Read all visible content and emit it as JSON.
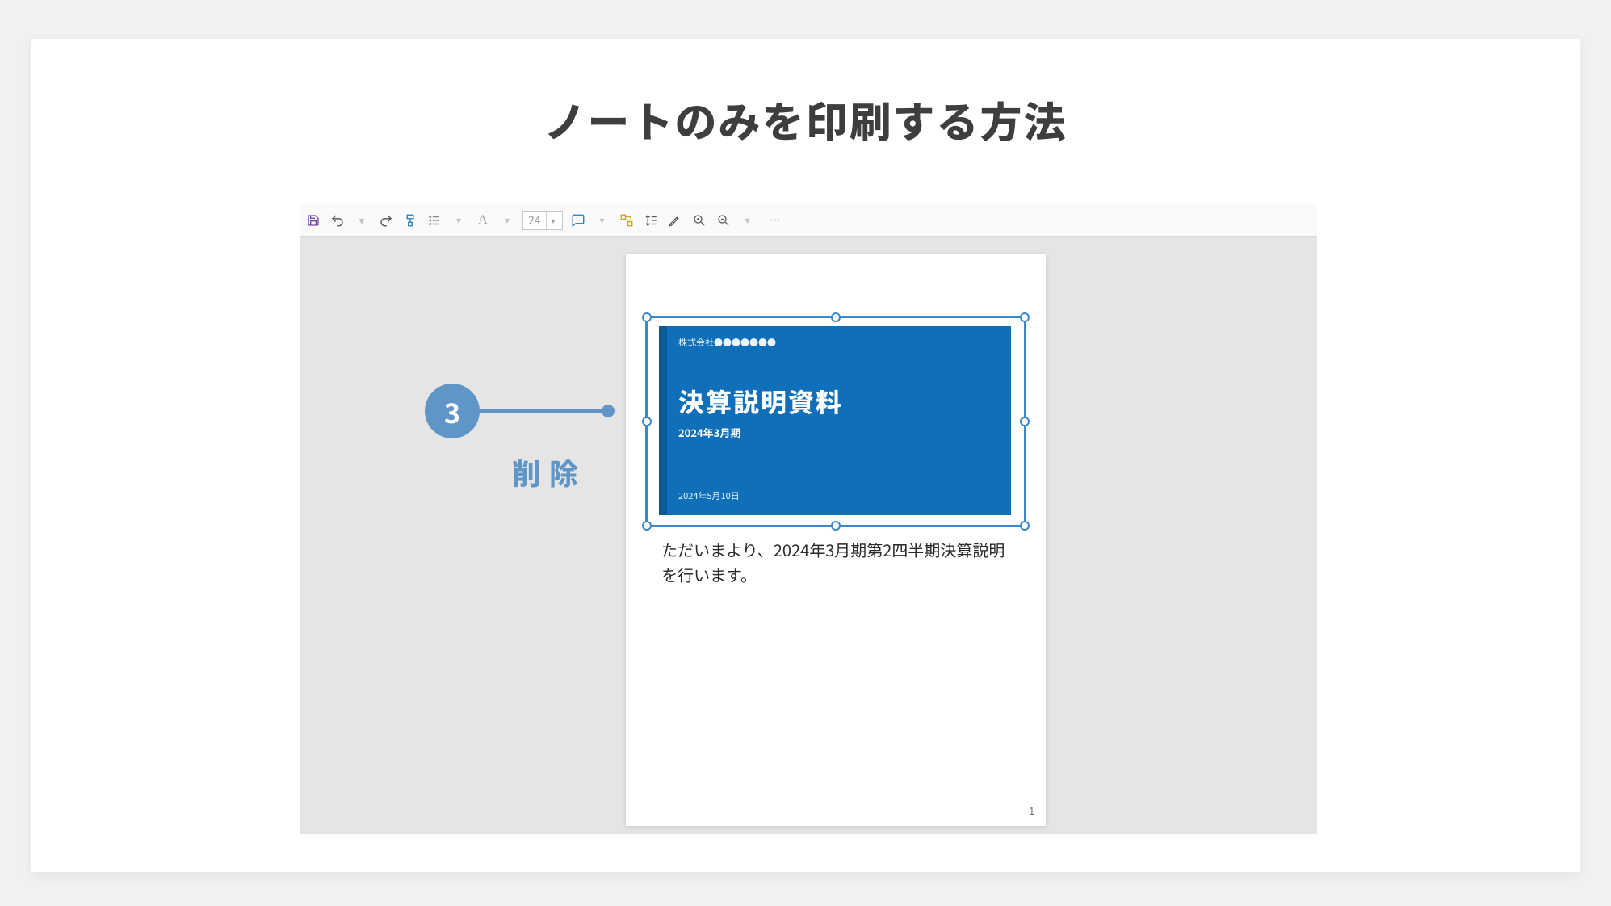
{
  "title": "ノートのみを印刷する方法",
  "step": {
    "number": "3",
    "label": "削除"
  },
  "toolbar": {
    "font_size": "24"
  },
  "slide": {
    "company": "株式会社●●●●●●●",
    "headline": "決算説明資料",
    "period": "2024年3月期",
    "pubdate": "2024年5月10日"
  },
  "notes": "ただいまより、2024年3月期第2四半期決算説明を行います。",
  "page_number": "1"
}
